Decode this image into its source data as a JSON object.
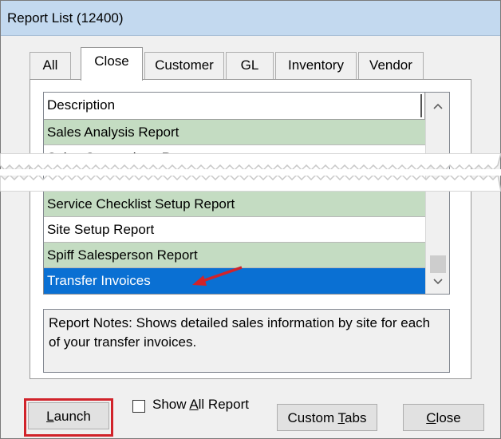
{
  "window": {
    "title": "Report List (12400)"
  },
  "tabs": [
    {
      "label": "All",
      "active": false
    },
    {
      "label": "Close",
      "active": true
    },
    {
      "label": "Customer",
      "active": false
    },
    {
      "label": "GL",
      "active": false
    },
    {
      "label": "Inventory",
      "active": false
    },
    {
      "label": "Vendor",
      "active": false
    }
  ],
  "list": {
    "header": "Description",
    "rows_top": [
      {
        "label": "Sales Analysis Report",
        "style": "green"
      },
      {
        "label": "Sales Comparison Report",
        "style": "white"
      }
    ],
    "rows_bottom": [
      {
        "label": "Service Checklist Setup Report",
        "style": "green"
      },
      {
        "label": "Site Setup Report",
        "style": "white"
      },
      {
        "label": "Spiff Salesperson Report",
        "style": "green"
      },
      {
        "label": "Transfer Invoices",
        "style": "selected"
      }
    ]
  },
  "notes": {
    "text": "Report Notes:  Shows detailed sales information by site for each of your transfer invoices."
  },
  "buttons": {
    "launch": "Launch",
    "show_all": "Show All Report",
    "custom_tabs": "Custom Tabs",
    "close": "Close"
  },
  "colors": {
    "row_green": "#c4dcc2",
    "selected": "#0a70d3",
    "highlight_box": "#d1232a",
    "arrow": "#d1232a"
  },
  "icons": {
    "scroll_up": "chevron-up-icon",
    "scroll_down": "chevron-down-icon",
    "pointer": "red-arrow-icon"
  }
}
